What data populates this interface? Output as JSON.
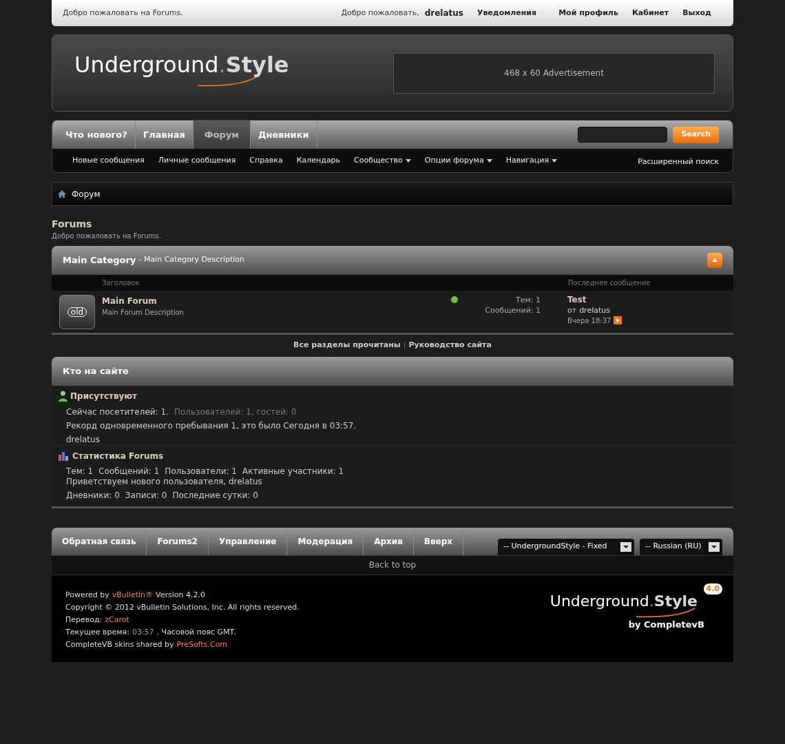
{
  "top_bar": {
    "welcome": "Добро пожаловать на Forums.",
    "greeting": "Добро пожаловать,",
    "username": "drelatus",
    "links": [
      {
        "label": "Уведомления",
        "dropdown": true
      },
      {
        "label": "Мой профиль",
        "dropdown": false
      },
      {
        "label": "Кабинет",
        "dropdown": false
      },
      {
        "label": "Выход",
        "dropdown": false
      }
    ]
  },
  "header": {
    "logo": {
      "word": "Underground",
      "dot": ".",
      "accent": "Style"
    },
    "ad": "468 x 60 Advertisement"
  },
  "nav": {
    "tabs": [
      {
        "label": "Что нового?",
        "selected": false
      },
      {
        "label": "Главная",
        "selected": false
      },
      {
        "label": "Форум",
        "selected": true
      },
      {
        "label": "Дневники",
        "selected": false
      }
    ],
    "search_button": "Search",
    "subnav": [
      {
        "label": "Новые сообщения",
        "dropdown": false
      },
      {
        "label": "Личные сообщения",
        "dropdown": false
      },
      {
        "label": "Справка",
        "dropdown": false
      },
      {
        "label": "Календарь",
        "dropdown": false
      },
      {
        "label": "Сообщество",
        "dropdown": true
      },
      {
        "label": "Опции форума",
        "dropdown": true
      },
      {
        "label": "Навигация",
        "dropdown": true
      }
    ],
    "advanced_search": "Расширенный поиск"
  },
  "breadcrumb": "Форум",
  "page": {
    "title": "Forums",
    "description": "Добро пожаловать на Forums."
  },
  "category": {
    "title": "Main Category",
    "description": "- Main Category Description",
    "columns": [
      "Заголовок",
      "Последнее сообщение"
    ],
    "forums": [
      {
        "icon_text": "old",
        "name": "Main Forum",
        "description": "Main Forum Description",
        "color": "#6ec24a",
        "threads": "Тем: 1",
        "posts": "Сообщений: 1",
        "last_post": {
          "title": "Test",
          "by": "от",
          "author": "drelatus",
          "time": "Вчера 18:37"
        }
      }
    ]
  },
  "links": [
    "Все разделы прочитаны",
    "Руководство сайта"
  ],
  "links_separator": "|",
  "whos_online": {
    "title": "Кто на сайте",
    "sections": [
      {
        "kind": "online",
        "heading": "Присутствуют",
        "lines": [
          [
            {
              "text": "Сейчас посетителей: 1.",
              "muted": false
            },
            {
              "text": "Пользователей: 1, гостей: 0",
              "muted": true
            }
          ],
          [
            {
              "text": "Рекорд одновременного пребывания 1, это было Сегодня в 03:57.",
              "muted": false
            }
          ],
          [
            {
              "text": "drelatus",
              "muted": false
            }
          ]
        ]
      },
      {
        "kind": "stats",
        "heading": "Статистика Forums",
        "lines": [
          [
            {
              "text": "Тем: 1",
              "muted": false
            },
            {
              "text": "Сообщений: 1",
              "muted": false
            },
            {
              "text": "Пользователи: 1",
              "muted": false
            },
            {
              "text": "Активные участники: 1",
              "muted": false
            }
          ],
          [
            {
              "text": "Приветствуем нового пользователя, drelatus",
              "muted": false
            }
          ],
          [
            {
              "text": "Дневники: 0",
              "muted": false
            },
            {
              "text": "Записи: 0",
              "muted": false
            },
            {
              "text": "Последние сутки: 0",
              "muted": false
            }
          ]
        ]
      }
    ]
  },
  "footer": {
    "tabs": [
      "Обратная связь",
      "Forums2",
      "Управление",
      "Модерация",
      "Архив",
      "Вверх"
    ],
    "selects": [
      "-- UndergroundStyle - Fixed",
      "-- Russian (RU)"
    ],
    "back_to_top": "Back to top",
    "credits": [
      [
        {
          "text": "Powered by",
          "kind": "plain"
        },
        {
          "text": "vBulletin®",
          "kind": "link"
        },
        {
          "text": "Version 4.2.0",
          "kind": "plain"
        }
      ],
      [
        {
          "text": "Copyright © 2012 vBulletin Solutions, Inc. All rights reserved.",
          "kind": "plain"
        }
      ],
      [
        {
          "text": "Перевод:",
          "kind": "plain"
        },
        {
          "text": "zCarot",
          "kind": "link"
        }
      ],
      [
        {
          "text": "Текущее время:",
          "kind": "plain"
        },
        {
          "text": "03:57",
          "kind": "muted"
        },
        {
          "text": ". Часовой пояс GMT.",
          "kind": "plain"
        }
      ],
      [
        {
          "text": "CompleteVB skins shared by",
          "kind": "plain"
        },
        {
          "text": "PreSofts.Com",
          "kind": "link"
        }
      ]
    ],
    "logo": {
      "word": "Underground",
      "dot": ".",
      "accent": "Style",
      "badge": "4.0",
      "byline": "by CompletevB"
    }
  }
}
